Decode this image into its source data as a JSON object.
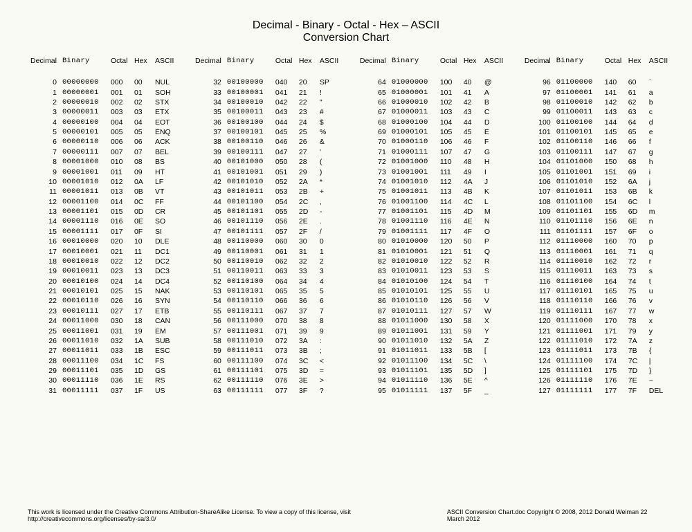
{
  "title": "Decimal - Binary - Octal - Hex – ASCII",
  "subtitle": "Conversion Chart",
  "headers": {
    "dec": "Decimal",
    "bin": "Binary",
    "oct": "Octal",
    "hex": "Hex",
    "asc": "ASCII"
  },
  "footer_left": "This work is licensed under the Creative Commons Attribution-ShareAlike License.  To view a copy of this license, visit  http://creativecommons.org/licenses/by-sa/3.0/",
  "footer_right": "ASCII Conversion Chart.doc     Copyright © 2008, 2012    Donald Weiman   22 March 2012",
  "chart_data": {
    "type": "table",
    "title": "Decimal - Binary - Octal - Hex – ASCII Conversion Chart",
    "columns": [
      "Decimal",
      "Binary",
      "Octal",
      "Hex",
      "ASCII"
    ],
    "groups": [
      [
        {
          "dec": "0",
          "bin": "00000000",
          "oct": "000",
          "hex": "00",
          "asc": "NUL"
        },
        {
          "dec": "1",
          "bin": "00000001",
          "oct": "001",
          "hex": "01",
          "asc": "SOH"
        },
        {
          "dec": "2",
          "bin": "00000010",
          "oct": "002",
          "hex": "02",
          "asc": "STX"
        },
        {
          "dec": "3",
          "bin": "00000011",
          "oct": "003",
          "hex": "03",
          "asc": "ETX"
        },
        {
          "dec": "4",
          "bin": "00000100",
          "oct": "004",
          "hex": "04",
          "asc": "EOT"
        },
        {
          "dec": "5",
          "bin": "00000101",
          "oct": "005",
          "hex": "05",
          "asc": "ENQ"
        },
        {
          "dec": "6",
          "bin": "00000110",
          "oct": "006",
          "hex": "06",
          "asc": "ACK"
        },
        {
          "dec": "7",
          "bin": "00000111",
          "oct": "007",
          "hex": "07",
          "asc": "BEL"
        },
        {
          "dec": "8",
          "bin": "00001000",
          "oct": "010",
          "hex": "08",
          "asc": "BS"
        },
        {
          "dec": "9",
          "bin": "00001001",
          "oct": "011",
          "hex": "09",
          "asc": "HT"
        },
        {
          "dec": "10",
          "bin": "00001010",
          "oct": "012",
          "hex": "0A",
          "asc": "LF"
        },
        {
          "dec": "11",
          "bin": "00001011",
          "oct": "013",
          "hex": "0B",
          "asc": "VT"
        },
        {
          "dec": "12",
          "bin": "00001100",
          "oct": "014",
          "hex": "0C",
          "asc": "FF"
        },
        {
          "dec": "13",
          "bin": "00001101",
          "oct": "015",
          "hex": "0D",
          "asc": "CR"
        },
        {
          "dec": "14",
          "bin": "00001110",
          "oct": "016",
          "hex": "0E",
          "asc": "SO"
        },
        {
          "dec": "15",
          "bin": "00001111",
          "oct": "017",
          "hex": "0F",
          "asc": "SI"
        },
        {
          "dec": "16",
          "bin": "00010000",
          "oct": "020",
          "hex": "10",
          "asc": "DLE"
        },
        {
          "dec": "17",
          "bin": "00010001",
          "oct": "021",
          "hex": "11",
          "asc": "DC1"
        },
        {
          "dec": "18",
          "bin": "00010010",
          "oct": "022",
          "hex": "12",
          "asc": "DC2"
        },
        {
          "dec": "19",
          "bin": "00010011",
          "oct": "023",
          "hex": "13",
          "asc": "DC3"
        },
        {
          "dec": "20",
          "bin": "00010100",
          "oct": "024",
          "hex": "14",
          "asc": "DC4"
        },
        {
          "dec": "21",
          "bin": "00010101",
          "oct": "025",
          "hex": "15",
          "asc": "NAK"
        },
        {
          "dec": "22",
          "bin": "00010110",
          "oct": "026",
          "hex": "16",
          "asc": "SYN"
        },
        {
          "dec": "23",
          "bin": "00010111",
          "oct": "027",
          "hex": "17",
          "asc": "ETB"
        },
        {
          "dec": "24",
          "bin": "00011000",
          "oct": "030",
          "hex": "18",
          "asc": "CAN"
        },
        {
          "dec": "25",
          "bin": "00011001",
          "oct": "031",
          "hex": "19",
          "asc": "EM"
        },
        {
          "dec": "26",
          "bin": "00011010",
          "oct": "032",
          "hex": "1A",
          "asc": "SUB"
        },
        {
          "dec": "27",
          "bin": "00011011",
          "oct": "033",
          "hex": "1B",
          "asc": "ESC"
        },
        {
          "dec": "28",
          "bin": "00011100",
          "oct": "034",
          "hex": "1C",
          "asc": "FS"
        },
        {
          "dec": "29",
          "bin": "00011101",
          "oct": "035",
          "hex": "1D",
          "asc": "GS"
        },
        {
          "dec": "30",
          "bin": "00011110",
          "oct": "036",
          "hex": "1E",
          "asc": "RS"
        },
        {
          "dec": "31",
          "bin": "00011111",
          "oct": "037",
          "hex": "1F",
          "asc": "US"
        }
      ],
      [
        {
          "dec": "32",
          "bin": "00100000",
          "oct": "040",
          "hex": "20",
          "asc": "SP"
        },
        {
          "dec": "33",
          "bin": "00100001",
          "oct": "041",
          "hex": "21",
          "asc": "!"
        },
        {
          "dec": "34",
          "bin": "00100010",
          "oct": "042",
          "hex": "22",
          "asc": "\""
        },
        {
          "dec": "35",
          "bin": "00100011",
          "oct": "043",
          "hex": "23",
          "asc": "#"
        },
        {
          "dec": "36",
          "bin": "00100100",
          "oct": "044",
          "hex": "24",
          "asc": "$"
        },
        {
          "dec": "37",
          "bin": "00100101",
          "oct": "045",
          "hex": "25",
          "asc": "%"
        },
        {
          "dec": "38",
          "bin": "00100110",
          "oct": "046",
          "hex": "26",
          "asc": "&"
        },
        {
          "dec": "39",
          "bin": "00100111",
          "oct": "047",
          "hex": "27",
          "asc": "'"
        },
        {
          "dec": "40",
          "bin": "00101000",
          "oct": "050",
          "hex": "28",
          "asc": "("
        },
        {
          "dec": "41",
          "bin": "00101001",
          "oct": "051",
          "hex": "29",
          "asc": ")"
        },
        {
          "dec": "42",
          "bin": "00101010",
          "oct": "052",
          "hex": "2A",
          "asc": "*"
        },
        {
          "dec": "43",
          "bin": "00101011",
          "oct": "053",
          "hex": "2B",
          "asc": "+"
        },
        {
          "dec": "44",
          "bin": "00101100",
          "oct": "054",
          "hex": "2C",
          "asc": ","
        },
        {
          "dec": "45",
          "bin": "00101101",
          "oct": "055",
          "hex": "2D",
          "asc": "-"
        },
        {
          "dec": "46",
          "bin": "00101110",
          "oct": "056",
          "hex": "2E",
          "asc": "."
        },
        {
          "dec": "47",
          "bin": "00101111",
          "oct": "057",
          "hex": "2F",
          "asc": "/"
        },
        {
          "dec": "48",
          "bin": "00110000",
          "oct": "060",
          "hex": "30",
          "asc": "0"
        },
        {
          "dec": "49",
          "bin": "00110001",
          "oct": "061",
          "hex": "31",
          "asc": "1"
        },
        {
          "dec": "50",
          "bin": "00110010",
          "oct": "062",
          "hex": "32",
          "asc": "2"
        },
        {
          "dec": "51",
          "bin": "00110011",
          "oct": "063",
          "hex": "33",
          "asc": "3"
        },
        {
          "dec": "52",
          "bin": "00110100",
          "oct": "064",
          "hex": "34",
          "asc": "4"
        },
        {
          "dec": "53",
          "bin": "00110101",
          "oct": "065",
          "hex": "35",
          "asc": "5"
        },
        {
          "dec": "54",
          "bin": "00110110",
          "oct": "066",
          "hex": "36",
          "asc": "6"
        },
        {
          "dec": "55",
          "bin": "00110111",
          "oct": "067",
          "hex": "37",
          "asc": "7"
        },
        {
          "dec": "56",
          "bin": "00111000",
          "oct": "070",
          "hex": "38",
          "asc": "8"
        },
        {
          "dec": "57",
          "bin": "00111001",
          "oct": "071",
          "hex": "39",
          "asc": "9"
        },
        {
          "dec": "58",
          "bin": "00111010",
          "oct": "072",
          "hex": "3A",
          "asc": ":"
        },
        {
          "dec": "59",
          "bin": "00111011",
          "oct": "073",
          "hex": "3B",
          "asc": ";"
        },
        {
          "dec": "60",
          "bin": "00111100",
          "oct": "074",
          "hex": "3C",
          "asc": "<"
        },
        {
          "dec": "61",
          "bin": "00111101",
          "oct": "075",
          "hex": "3D",
          "asc": "="
        },
        {
          "dec": "62",
          "bin": "00111110",
          "oct": "076",
          "hex": "3E",
          "asc": ">"
        },
        {
          "dec": "63",
          "bin": "00111111",
          "oct": "077",
          "hex": "3F",
          "asc": "?"
        }
      ],
      [
        {
          "dec": "64",
          "bin": "01000000",
          "oct": "100",
          "hex": "40",
          "asc": "@"
        },
        {
          "dec": "65",
          "bin": "01000001",
          "oct": "101",
          "hex": "41",
          "asc": "A"
        },
        {
          "dec": "66",
          "bin": "01000010",
          "oct": "102",
          "hex": "42",
          "asc": "B"
        },
        {
          "dec": "67",
          "bin": "01000011",
          "oct": "103",
          "hex": "43",
          "asc": "C"
        },
        {
          "dec": "68",
          "bin": "01000100",
          "oct": "104",
          "hex": "44",
          "asc": "D"
        },
        {
          "dec": "69",
          "bin": "01000101",
          "oct": "105",
          "hex": "45",
          "asc": "E"
        },
        {
          "dec": "70",
          "bin": "01000110",
          "oct": "106",
          "hex": "46",
          "asc": "F"
        },
        {
          "dec": "71",
          "bin": "01000111",
          "oct": "107",
          "hex": "47",
          "asc": "G"
        },
        {
          "dec": "72",
          "bin": "01001000",
          "oct": "110",
          "hex": "48",
          "asc": "H"
        },
        {
          "dec": "73",
          "bin": "01001001",
          "oct": "111",
          "hex": "49",
          "asc": "I"
        },
        {
          "dec": "74",
          "bin": "01001010",
          "oct": "112",
          "hex": "4A",
          "asc": "J"
        },
        {
          "dec": "75",
          "bin": "01001011",
          "oct": "113",
          "hex": "4B",
          "asc": "K"
        },
        {
          "dec": "76",
          "bin": "01001100",
          "oct": "114",
          "hex": "4C",
          "asc": "L"
        },
        {
          "dec": "77",
          "bin": "01001101",
          "oct": "115",
          "hex": "4D",
          "asc": "M"
        },
        {
          "dec": "78",
          "bin": "01001110",
          "oct": "116",
          "hex": "4E",
          "asc": "N"
        },
        {
          "dec": "79",
          "bin": "01001111",
          "oct": "117",
          "hex": "4F",
          "asc": "O"
        },
        {
          "dec": "80",
          "bin": "01010000",
          "oct": "120",
          "hex": "50",
          "asc": "P"
        },
        {
          "dec": "81",
          "bin": "01010001",
          "oct": "121",
          "hex": "51",
          "asc": "Q"
        },
        {
          "dec": "82",
          "bin": "01010010",
          "oct": "122",
          "hex": "52",
          "asc": "R"
        },
        {
          "dec": "83",
          "bin": "01010011",
          "oct": "123",
          "hex": "53",
          "asc": "S"
        },
        {
          "dec": "84",
          "bin": "01010100",
          "oct": "124",
          "hex": "54",
          "asc": "T"
        },
        {
          "dec": "85",
          "bin": "01010101",
          "oct": "125",
          "hex": "55",
          "asc": "U"
        },
        {
          "dec": "86",
          "bin": "01010110",
          "oct": "126",
          "hex": "56",
          "asc": "V"
        },
        {
          "dec": "87",
          "bin": "01010111",
          "oct": "127",
          "hex": "57",
          "asc": "W"
        },
        {
          "dec": "88",
          "bin": "01011000",
          "oct": "130",
          "hex": "58",
          "asc": "X"
        },
        {
          "dec": "89",
          "bin": "01011001",
          "oct": "131",
          "hex": "59",
          "asc": "Y"
        },
        {
          "dec": "90",
          "bin": "01011010",
          "oct": "132",
          "hex": "5A",
          "asc": "Z"
        },
        {
          "dec": "91",
          "bin": "01011011",
          "oct": "133",
          "hex": "5B",
          "asc": "["
        },
        {
          "dec": "92",
          "bin": "01011100",
          "oct": "134",
          "hex": "5C",
          "asc": "\\"
        },
        {
          "dec": "93",
          "bin": "01011101",
          "oct": "135",
          "hex": "5D",
          "asc": "]"
        },
        {
          "dec": "94",
          "bin": "01011110",
          "oct": "136",
          "hex": "5E",
          "asc": "^"
        },
        {
          "dec": "95",
          "bin": "01011111",
          "oct": "137",
          "hex": "5F",
          "asc": "_"
        }
      ],
      [
        {
          "dec": "96",
          "bin": "01100000",
          "oct": "140",
          "hex": "60",
          "asc": "`"
        },
        {
          "dec": "97",
          "bin": "01100001",
          "oct": "141",
          "hex": "61",
          "asc": "a"
        },
        {
          "dec": "98",
          "bin": "01100010",
          "oct": "142",
          "hex": "62",
          "asc": "b"
        },
        {
          "dec": "99",
          "bin": "01100011",
          "oct": "143",
          "hex": "63",
          "asc": "c"
        },
        {
          "dec": "100",
          "bin": "01100100",
          "oct": "144",
          "hex": "64",
          "asc": "d"
        },
        {
          "dec": "101",
          "bin": "01100101",
          "oct": "145",
          "hex": "65",
          "asc": "e"
        },
        {
          "dec": "102",
          "bin": "01100110",
          "oct": "146",
          "hex": "66",
          "asc": "f"
        },
        {
          "dec": "103",
          "bin": "01100111",
          "oct": "147",
          "hex": "67",
          "asc": "g"
        },
        {
          "dec": "104",
          "bin": "01101000",
          "oct": "150",
          "hex": "68",
          "asc": "h"
        },
        {
          "dec": "105",
          "bin": "01101001",
          "oct": "151",
          "hex": "69",
          "asc": "i"
        },
        {
          "dec": "106",
          "bin": "01101010",
          "oct": "152",
          "hex": "6A",
          "asc": "j"
        },
        {
          "dec": "107",
          "bin": "01101011",
          "oct": "153",
          "hex": "6B",
          "asc": "k"
        },
        {
          "dec": "108",
          "bin": "01101100",
          "oct": "154",
          "hex": "6C",
          "asc": "l"
        },
        {
          "dec": "109",
          "bin": "01101101",
          "oct": "155",
          "hex": "6D",
          "asc": "m"
        },
        {
          "dec": "110",
          "bin": "01101110",
          "oct": "156",
          "hex": "6E",
          "asc": "n"
        },
        {
          "dec": "111",
          "bin": "01101111",
          "oct": "157",
          "hex": "6F",
          "asc": "o"
        },
        {
          "dec": "112",
          "bin": "01110000",
          "oct": "160",
          "hex": "70",
          "asc": "p"
        },
        {
          "dec": "113",
          "bin": "01110001",
          "oct": "161",
          "hex": "71",
          "asc": "q"
        },
        {
          "dec": "114",
          "bin": "01110010",
          "oct": "162",
          "hex": "72",
          "asc": "r"
        },
        {
          "dec": "115",
          "bin": "01110011",
          "oct": "163",
          "hex": "73",
          "asc": "s"
        },
        {
          "dec": "116",
          "bin": "01110100",
          "oct": "164",
          "hex": "74",
          "asc": "t"
        },
        {
          "dec": "117",
          "bin": "01110101",
          "oct": "165",
          "hex": "75",
          "asc": "u"
        },
        {
          "dec": "118",
          "bin": "01110110",
          "oct": "166",
          "hex": "76",
          "asc": "v"
        },
        {
          "dec": "119",
          "bin": "01110111",
          "oct": "167",
          "hex": "77",
          "asc": "w"
        },
        {
          "dec": "120",
          "bin": "01111000",
          "oct": "170",
          "hex": "78",
          "asc": "x"
        },
        {
          "dec": "121",
          "bin": "01111001",
          "oct": "171",
          "hex": "79",
          "asc": "y"
        },
        {
          "dec": "122",
          "bin": "01111010",
          "oct": "172",
          "hex": "7A",
          "asc": "z"
        },
        {
          "dec": "123",
          "bin": "01111011",
          "oct": "173",
          "hex": "7B",
          "asc": "{"
        },
        {
          "dec": "124",
          "bin": "01111100",
          "oct": "174",
          "hex": "7C",
          "asc": "|"
        },
        {
          "dec": "125",
          "bin": "01111101",
          "oct": "175",
          "hex": "7D",
          "asc": "}"
        },
        {
          "dec": "126",
          "bin": "01111110",
          "oct": "176",
          "hex": "7E",
          "asc": "~"
        },
        {
          "dec": "127",
          "bin": "01111111",
          "oct": "177",
          "hex": "7F",
          "asc": "DEL"
        }
      ]
    ]
  }
}
